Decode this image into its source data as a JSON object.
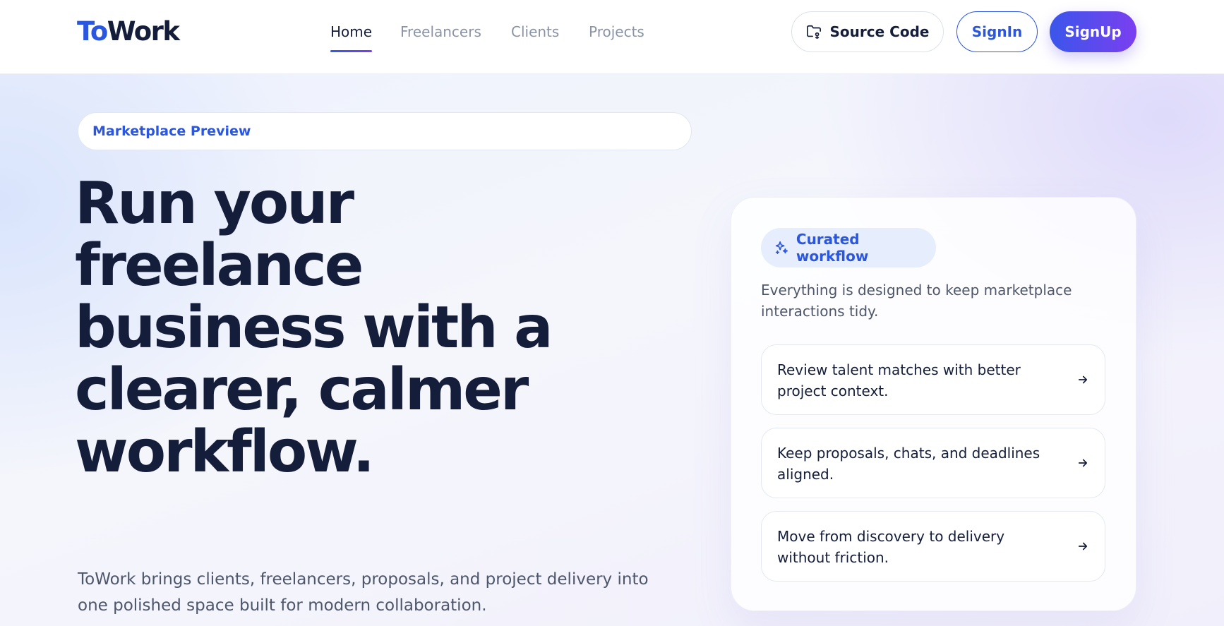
{
  "header": {
    "logo_prefix": "To",
    "logo_suffix": "Work",
    "nav": [
      {
        "label": "Home",
        "active": true
      },
      {
        "label": "Freelancers",
        "active": false
      },
      {
        "label": "Clients",
        "active": false
      },
      {
        "label": "Projects",
        "active": false
      }
    ],
    "source_code_label": "Source Code",
    "source_code_icon": "folder-code-icon",
    "signin_label": "SignIn",
    "signup_label": "SignUp"
  },
  "hero": {
    "preview_label": "Marketplace Preview",
    "title": "Run your freelance business with a clearer, calmer workflow.",
    "subtitle": "ToWork brings clients, freelancers, proposals, and project delivery into one polished space built for modern collaboration."
  },
  "card": {
    "badge_label": "Curated workflow",
    "badge_icon": "sparkle-icon",
    "description": "Everything is designed to keep marketplace interactions tidy.",
    "steps": [
      {
        "text": "Review talent matches with better project context."
      },
      {
        "text": "Keep proposals, chats, and deadlines aligned."
      },
      {
        "text": "Move from discovery to delivery without friction."
      }
    ],
    "arrow_icon": "arrow-right-icon"
  },
  "colors": {
    "brand_blue": "#2a56e0",
    "brand_purple": "#7b3ff0",
    "ink": "#141d3a",
    "muted": "#8b93a7"
  }
}
